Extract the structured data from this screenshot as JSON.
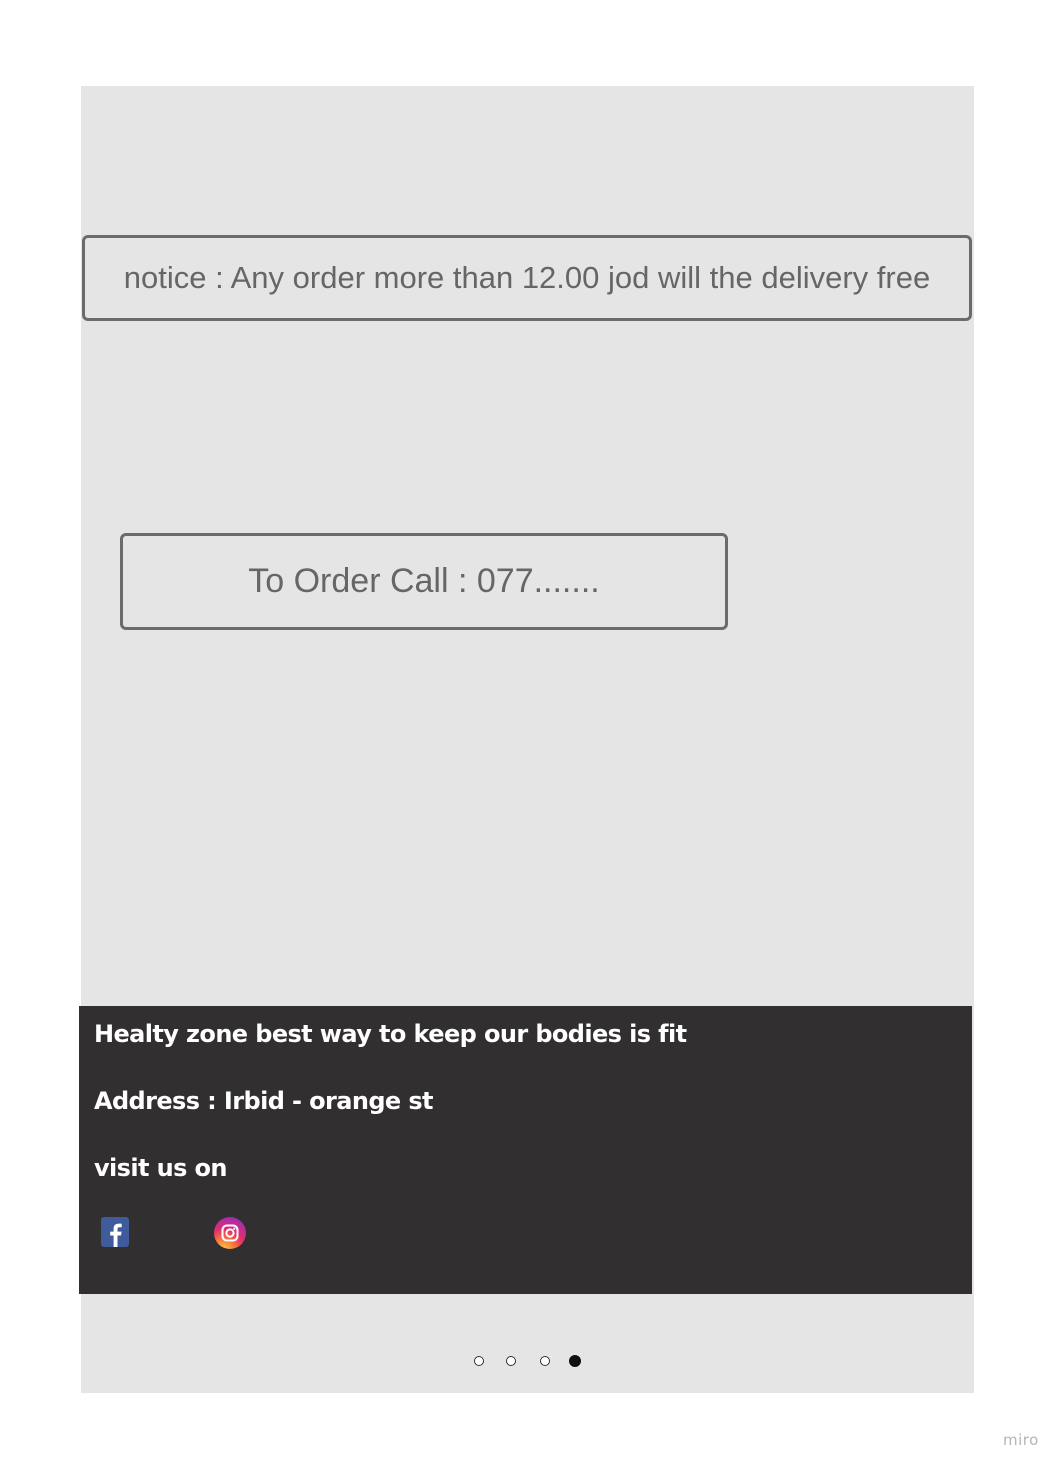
{
  "notice": {
    "text": "notice : Any order more than 12.00 jod will the delivery free"
  },
  "order": {
    "text": "To Order Call : 077......."
  },
  "footer": {
    "tagline": "Healty zone best way to keep our bodies is fit",
    "address": "Address : Irbid - orange st",
    "visit_label": "visit us on",
    "social": [
      {
        "icon": "facebook-icon",
        "color": "#3b5998"
      },
      {
        "icon": "instagram-icon",
        "color": "#d6249f"
      }
    ],
    "background": "#312f30"
  },
  "carousel": {
    "total_slides": 4,
    "active_index": 3
  },
  "watermark": "miro",
  "colors": {
    "frame_bg": "#e5e5e5",
    "box_border": "#6b6b6b",
    "box_text": "#666666"
  }
}
